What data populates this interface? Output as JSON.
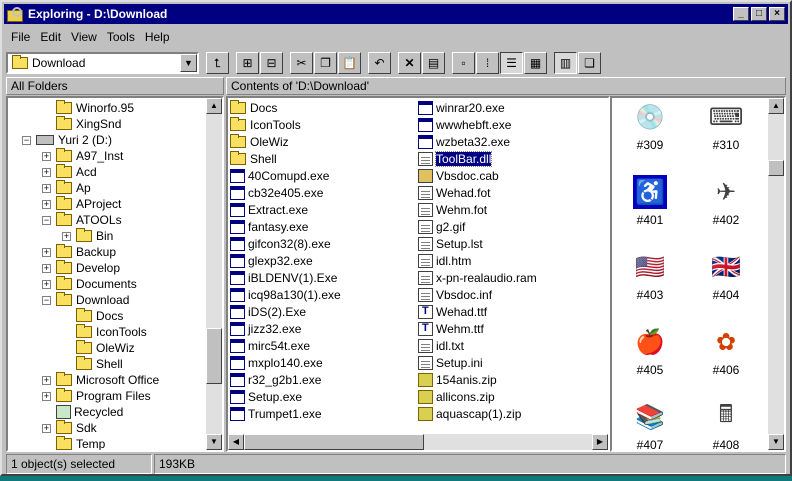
{
  "window": {
    "title": "Exploring - D:\\Download",
    "min": "_",
    "max": "□",
    "close": "×"
  },
  "menu": [
    "File",
    "Edit",
    "View",
    "Tools",
    "Help"
  ],
  "address": {
    "value": "Download"
  },
  "tree_header": "All Folders",
  "contents_header": "Contents of 'D:\\Download'",
  "tree": [
    {
      "label": "Winorfo.95",
      "level": 2,
      "type": "folder"
    },
    {
      "label": "XingSnd",
      "level": 2,
      "type": "folder"
    },
    {
      "label": "Yuri 2 (D:)",
      "level": 1,
      "type": "drive",
      "toggle": "−"
    },
    {
      "label": "A97_Inst",
      "level": 2,
      "type": "folder",
      "toggle": "+"
    },
    {
      "label": "Acd",
      "level": 2,
      "type": "folder",
      "toggle": "+"
    },
    {
      "label": "Ap",
      "level": 2,
      "type": "folder",
      "toggle": "+"
    },
    {
      "label": "AProject",
      "level": 2,
      "type": "folder",
      "toggle": "+"
    },
    {
      "label": "ATOOLs",
      "level": 2,
      "type": "folder",
      "toggle": "−"
    },
    {
      "label": "Bin",
      "level": 3,
      "type": "folder",
      "toggle": "+"
    },
    {
      "label": "Backup",
      "level": 2,
      "type": "folder",
      "toggle": "+"
    },
    {
      "label": "Develop",
      "level": 2,
      "type": "folder",
      "toggle": "+"
    },
    {
      "label": "Documents",
      "level": 2,
      "type": "folder",
      "toggle": "+"
    },
    {
      "label": "Download",
      "level": 2,
      "type": "folder",
      "toggle": "−"
    },
    {
      "label": "Docs",
      "level": 3,
      "type": "folder"
    },
    {
      "label": "IconTools",
      "level": 3,
      "type": "folder"
    },
    {
      "label": "OleWiz",
      "level": 3,
      "type": "folder"
    },
    {
      "label": "Shell",
      "level": 3,
      "type": "folder"
    },
    {
      "label": "Microsoft Office",
      "level": 2,
      "type": "folder",
      "toggle": "+"
    },
    {
      "label": "Program Files",
      "level": 2,
      "type": "folder",
      "toggle": "+"
    },
    {
      "label": "Recycled",
      "level": 2,
      "type": "recycle"
    },
    {
      "label": "Sdk",
      "level": 2,
      "type": "folder",
      "toggle": "+"
    },
    {
      "label": "Temp",
      "level": 2,
      "type": "folder"
    }
  ],
  "files_col1": [
    {
      "name": "Docs",
      "kind": "fld"
    },
    {
      "name": "IconTools",
      "kind": "fld"
    },
    {
      "name": "OleWiz",
      "kind": "fld"
    },
    {
      "name": "Shell",
      "kind": "fld"
    },
    {
      "name": "40Comupd.exe",
      "kind": "exe"
    },
    {
      "name": "cb32e405.exe",
      "kind": "exe"
    },
    {
      "name": "Extract.exe",
      "kind": "exe"
    },
    {
      "name": "fantasy.exe",
      "kind": "exe"
    },
    {
      "name": "gifcon32(8).exe",
      "kind": "exe"
    },
    {
      "name": "glexp32.exe",
      "kind": "exe"
    },
    {
      "name": "iBLDENV(1).Exe",
      "kind": "exe"
    },
    {
      "name": "icq98a130(1).exe",
      "kind": "exe"
    },
    {
      "name": "iDS(2).Exe",
      "kind": "exe"
    },
    {
      "name": "jizz32.exe",
      "kind": "exe"
    },
    {
      "name": "mirc54t.exe",
      "kind": "exe"
    },
    {
      "name": "mxplo140.exe",
      "kind": "exe"
    },
    {
      "name": "r32_g2b1.exe",
      "kind": "exe"
    },
    {
      "name": "Setup.exe",
      "kind": "exe"
    },
    {
      "name": "Trumpet1.exe",
      "kind": "exe"
    }
  ],
  "files_col2": [
    {
      "name": "winrar20.exe",
      "kind": "exe"
    },
    {
      "name": "wwwhebft.exe",
      "kind": "exe"
    },
    {
      "name": "wzbeta32.exe",
      "kind": "exe"
    },
    {
      "name": "ToolBar.dll",
      "kind": "doc",
      "selected": true
    },
    {
      "name": "Vbsdoc.cab",
      "kind": "cab"
    },
    {
      "name": "Wehad.fot",
      "kind": "doc"
    },
    {
      "name": "Wehm.fot",
      "kind": "doc"
    },
    {
      "name": "g2.gif",
      "kind": "doc"
    },
    {
      "name": "Setup.lst",
      "kind": "doc"
    },
    {
      "name": "idl.htm",
      "kind": "doc"
    },
    {
      "name": "x-pn-realaudio.ram",
      "kind": "doc"
    },
    {
      "name": "Vbsdoc.inf",
      "kind": "doc"
    },
    {
      "name": "Wehad.ttf",
      "kind": "font"
    },
    {
      "name": "Wehm.ttf",
      "kind": "font"
    },
    {
      "name": "idl.txt",
      "kind": "doc"
    },
    {
      "name": "Setup.ini",
      "kind": "doc"
    },
    {
      "name": "154anis.zip",
      "kind": "zip"
    },
    {
      "name": "allicons.zip",
      "kind": "zip"
    },
    {
      "name": "aquascap(1).zip",
      "kind": "zip"
    }
  ],
  "icons": [
    {
      "label": "#309",
      "glyph": "💿"
    },
    {
      "label": "#310",
      "glyph": "⌨"
    },
    {
      "label": "#401",
      "glyph": "♿"
    },
    {
      "label": "#402",
      "glyph": "✈"
    },
    {
      "label": "#403",
      "glyph": "🇺🇸"
    },
    {
      "label": "#404",
      "glyph": "🇬🇧"
    },
    {
      "label": "#405",
      "glyph": "🍎"
    },
    {
      "label": "#406",
      "glyph": "✿"
    },
    {
      "label": "#407",
      "glyph": "📚"
    },
    {
      "label": "#408",
      "glyph": "🖩"
    }
  ],
  "status": {
    "selected": "1 object(s) selected",
    "size": "193KB"
  }
}
